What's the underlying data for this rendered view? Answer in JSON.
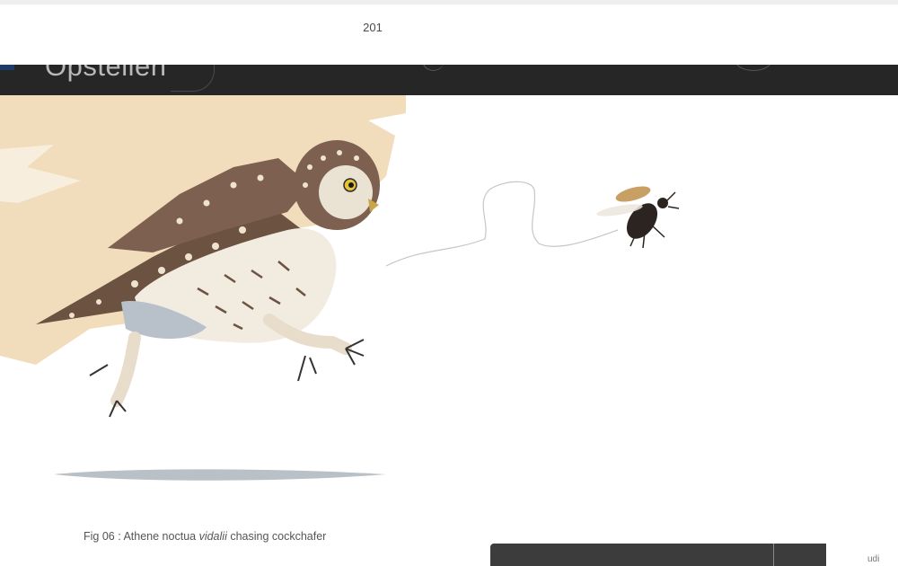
{
  "header": {
    "page_number": "201"
  },
  "band": {
    "title": "Opstellen"
  },
  "figure": {
    "caption_prefix": "Fig 06 : Athene noctua ",
    "caption_italic": "vidalii",
    "caption_suffix": " chasing cockchafer"
  },
  "footer": {
    "partial_label": "udi"
  },
  "colors": {
    "band": "#262626",
    "wash": "#f0d9b5",
    "owl_brown": "#6b5241",
    "shadow": "#b9c0c6"
  }
}
